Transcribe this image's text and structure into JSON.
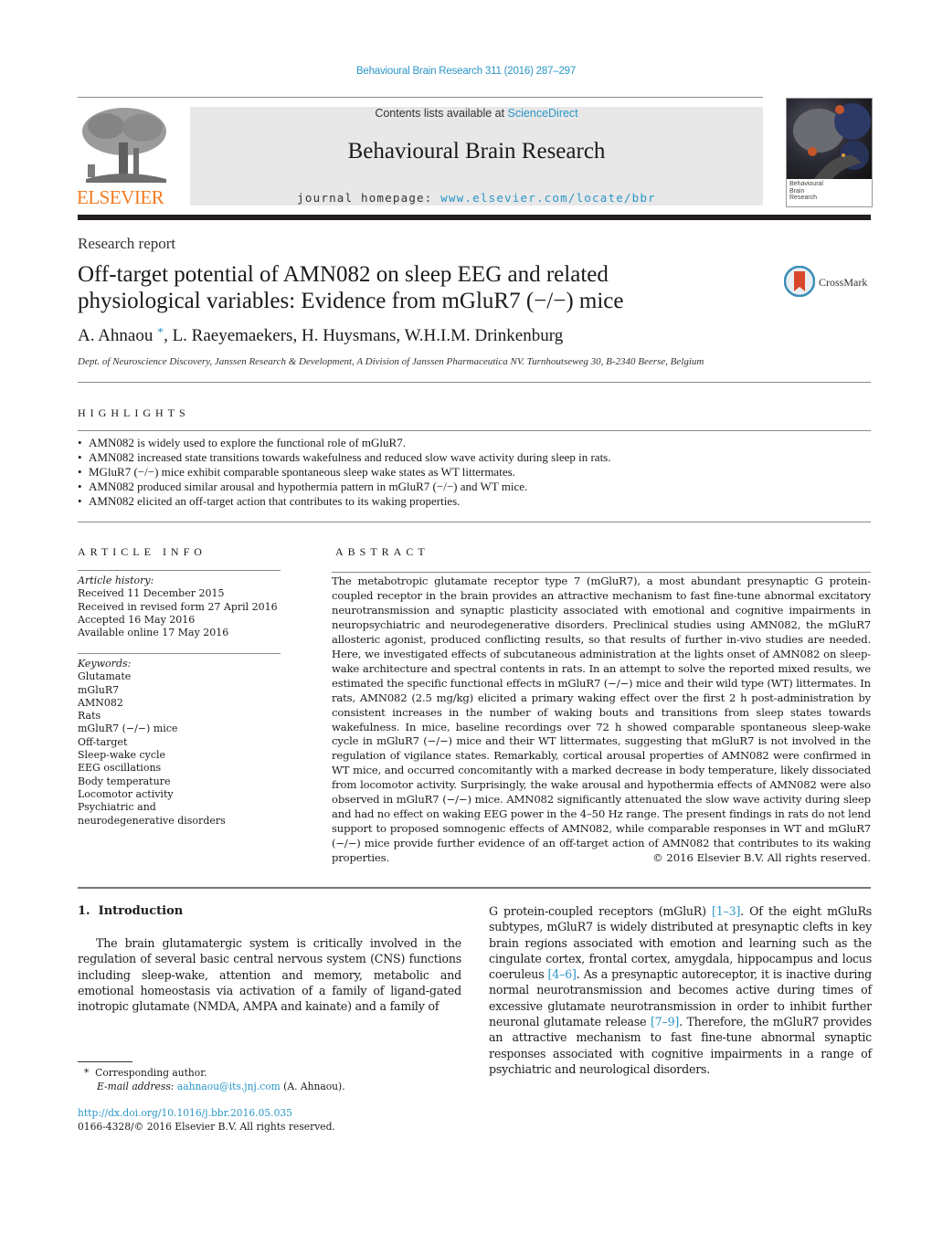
{
  "journal_ref": "Behavioural Brain Research 311 (2016) 287–297",
  "publisher": {
    "logo_word": "ELSEVIER",
    "colors": {
      "brand_orange": "#f47b20",
      "link_blue": "#2a96c8"
    }
  },
  "masthead": {
    "contents_prefix": "Contents lists available at ",
    "contents_link": "ScienceDirect",
    "journal_title": "Behavioural Brain Research",
    "homepage_prefix": "journal homepage: ",
    "homepage_link": "www.elsevier.com/locate/bbr"
  },
  "cover": {
    "lines": [
      "Behavioural",
      "Brain",
      "Research"
    ]
  },
  "article": {
    "type": "Research report",
    "title_line1": "Off-target potential of AMN082 on sleep EEG and related",
    "title_line2": "physiological variables: Evidence from mGluR7 (−/−) mice",
    "crossmark_label": "CrossMark",
    "authors": [
      {
        "name": "A. Ahnaou",
        "mark": "*"
      },
      {
        "name": "L. Raeyemaekers"
      },
      {
        "name": "H. Huysmans"
      },
      {
        "name": "W.H.I.M. Drinkenburg"
      }
    ],
    "affiliation": "Dept. of Neuroscience Discovery, Janssen Research & Development, A Division of Janssen Pharmaceutica NV. Turnhoutseweg 30, B-2340 Beerse, Belgium"
  },
  "highlights": {
    "heading": "HIGHLIGHTS",
    "items": [
      "AMN082 is widely used to explore the functional role of mGluR7.",
      "AMN082 increased state transitions towards wakefulness and reduced slow wave activity during sleep in rats.",
      "MGluR7 (−/−) mice exhibit comparable spontaneous sleep wake states as WT littermates.",
      "AMN082 produced similar arousal and hypothermia pattern in mGluR7 (−/−) and WT mice.",
      "AMN082 elicited an off-target action that contributes to its waking properties."
    ]
  },
  "article_info": {
    "heading": "ARTICLE INFO",
    "history_label": "Article history:",
    "history": [
      "Received 11 December 2015",
      "Received in revised form 27 April 2016",
      "Accepted 16 May 2016",
      "Available online 17 May 2016"
    ],
    "keywords_label": "Keywords:",
    "keywords": [
      "Glutamate",
      "mGluR7",
      "AMN082",
      "Rats",
      "mGluR7 (−/−) mice",
      "Off-target",
      "Sleep-wake cycle",
      "EEG oscillations",
      "Body temperature",
      "Locomotor activity",
      "Psychiatric and neurodegenerative disorders"
    ]
  },
  "abstract": {
    "heading": "ABSTRACT",
    "text": "The metabotropic glutamate receptor type 7 (mGluR7), a most abundant presynaptic G protein-coupled receptor in the brain provides an attractive mechanism to fast fine-tune abnormal excitatory neurotransmission and synaptic plasticity associated with emotional and cognitive impairments in neuropsychiatric and neurodegenerative disorders. Preclinical studies using AMN082, the mGluR7 allosteric agonist, produced conflicting results, so that results of further in-vivo studies are needed. Here, we investigated effects of subcutaneous administration at the lights onset of AMN082 on sleep-wake architecture and spectral contents in rats. In an attempt to solve the reported mixed results, we estimated the specific functional effects in mGluR7 (−/−) mice and their wild type (WT) littermates. In rats, AMN082 (2.5 mg/kg) elicited a primary waking effect over the first 2 h post-administration by consistent increases in the number of waking bouts and transitions from sleep states towards wakefulness. In mice, baseline recordings over 72 h showed comparable spontaneous sleep-wake cycle in mGluR7 (−/−) mice and their WT littermates, suggesting that mGluR7 is not involved in the regulation of vigilance states. Remarkably, cortical arousal properties of AMN082 were confirmed in WT mice, and occurred concomitantly with a marked decrease in body temperature, likely dissociated from locomotor activity. Surprisingly, the wake arousal and hypothermia effects of AMN082 were also observed in mGluR7 (−/−) mice. AMN082 significantly attenuated the slow wave activity during sleep and had no effect on waking EEG power in the 4–50 Hz range. The present findings in rats do not lend support to proposed somnogenic effects of AMN082, while comparable responses in WT and mGluR7 (−/−) mice provide further evidence of an off-target action of AMN082 that contributes to its waking properties.",
    "copyright": "© 2016 Elsevier B.V. All rights reserved."
  },
  "introduction": {
    "heading": "1.  Introduction",
    "col1_text": "The brain glutamatergic system is critically involved in the regulation of several basic central nervous system (CNS) functions including sleep-wake, attention and memory, metabolic and emotional homeostasis via activation of a family of ligand-gated inotropic glutamate (NMDA, AMPA and kainate) and a family of",
    "col2_parts": [
      {
        "text": "G protein-coupled receptors (mGluR) "
      },
      {
        "text": "[1–3]",
        "link": true
      },
      {
        "text": ". Of the eight mGluRs subtypes, mGluR7 is widely distributed at presynaptic clefts in key brain regions associated with emotion and learning such as the cingulate cortex, frontal cortex, amygdala, hippocampus and locus coeruleus "
      },
      {
        "text": "[4–6]",
        "link": true
      },
      {
        "text": ". As a presynaptic autoreceptor, it is inactive during normal neurotransmission and becomes active during times of excessive glutamate neurotransmission in order to inhibit further neuronal glutamate release "
      },
      {
        "text": "[7–9]",
        "link": true
      },
      {
        "text": ". Therefore, the mGluR7 provides an attractive mechanism to fast fine-tune abnormal synaptic responses associated with cognitive impairments in a range of psychiatric and neurological disorders."
      }
    ]
  },
  "footnote": {
    "mark": "*",
    "corresponding": "Corresponding author.",
    "email_label": "E-mail address:",
    "email": "aahnaou@its.jnj.com",
    "email_suffix": " (A. Ahnaou)."
  },
  "doi": {
    "url": "http://dx.doi.org/10.1016/j.bbr.2016.05.035",
    "issn_line": "0166-4328/© 2016 Elsevier B.V. All rights reserved."
  }
}
